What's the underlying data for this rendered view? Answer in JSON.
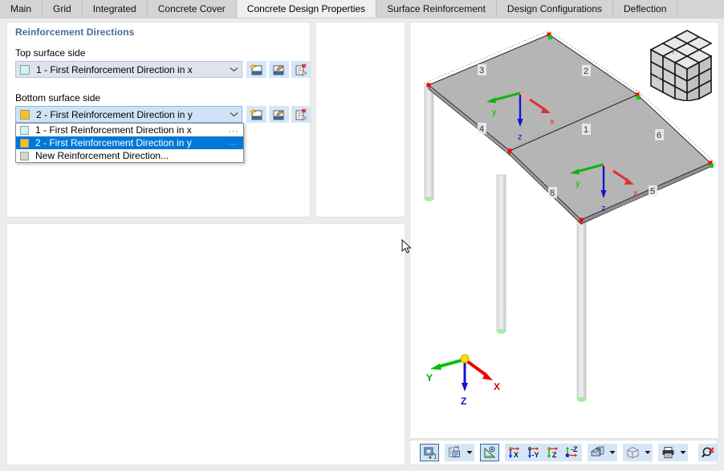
{
  "tabs": [
    {
      "label": "Main",
      "active": false
    },
    {
      "label": "Grid",
      "active": false
    },
    {
      "label": "Integrated",
      "active": false
    },
    {
      "label": "Concrete Cover",
      "active": false
    },
    {
      "label": "Concrete Design Properties",
      "active": true
    },
    {
      "label": "Surface Reinforcement",
      "active": false
    },
    {
      "label": "Design Configurations",
      "active": false
    },
    {
      "label": "Deflection",
      "active": false
    }
  ],
  "panel": {
    "title": "Reinforcement Directions",
    "top_label": "Top surface side",
    "bottom_label": "Bottom surface side",
    "top_combo": {
      "value": "1 - First Reinforcement Direction in x",
      "swatch_color": "#ccf5f5"
    },
    "bottom_combo": {
      "value": "2 - First Reinforcement Direction in y",
      "swatch_color": "#fcbe1e"
    },
    "row_buttons": [
      {
        "name": "new-reinforcement-direction-button",
        "icon": "new-window-icon",
        "tooltip": "New"
      },
      {
        "name": "edit-reinforcement-direction-button",
        "icon": "edit-window-icon",
        "tooltip": "Edit"
      },
      {
        "name": "delete-reinforcement-direction-button",
        "icon": "delete-entry-icon",
        "tooltip": "Delete"
      }
    ],
    "dropdown": {
      "open": true,
      "items": [
        {
          "label": "1 - First Reinforcement Direction in x",
          "swatch_color": "#ccf5f5",
          "selected": false,
          "has_ellipsis": true,
          "ellipsis": "..."
        },
        {
          "label": "2 - First Reinforcement Direction in y",
          "swatch_color": "#fcbe1e",
          "selected": true,
          "has_ellipsis": true,
          "ellipsis": "..."
        },
        {
          "label": "New Reinforcement Direction...",
          "swatch_color": "#d4d4d4",
          "selected": false,
          "has_ellipsis": false,
          "ellipsis": ""
        }
      ]
    }
  },
  "viewport": {
    "surface_labels": [
      "1",
      "2",
      "3",
      "4",
      "5",
      "6",
      "8"
    ],
    "local_axes": [
      {
        "x": "x",
        "y": "y",
        "z": "z"
      },
      {
        "x": "x",
        "y": "y",
        "z": "z"
      }
    ],
    "global_axes": {
      "x": "X",
      "y": "Y",
      "z": "Z"
    },
    "colors": {
      "axis_x": "#e03030",
      "axis_y": "#10b410",
      "axis_z": "#1414d2",
      "surface_fill": "#b5b5b5",
      "node_red": "#ff0000",
      "node_green": "#00d000"
    }
  },
  "view_toolbar": {
    "buttons": [
      {
        "name": "rendering-toggle-button",
        "icon": "render-mode-icon",
        "framed": true,
        "arrow": false
      },
      {
        "name": "display-properties-button",
        "icon": "display-properties-icon",
        "framed": false,
        "arrow": true
      },
      {
        "name": "measure-button",
        "icon": "ruler-protractor-icon",
        "framed": true,
        "arrow": false
      },
      {
        "name": "view-in-x-button",
        "icon": "view-x-icon",
        "label": "X",
        "framed": false,
        "arrow": false
      },
      {
        "name": "view-in-minus-y-button",
        "icon": "view-minus-y-icon",
        "label": "-Y",
        "framed": false,
        "arrow": false
      },
      {
        "name": "view-in-z-button",
        "icon": "view-z-icon",
        "label": "Z",
        "framed": false,
        "arrow": false
      },
      {
        "name": "view-in-minus-z-button",
        "icon": "view-minus-z-icon",
        "label": "-Z",
        "framed": false,
        "arrow": false
      },
      {
        "name": "shading-mode-button",
        "icon": "solid-blocks-icon",
        "framed": false,
        "arrow": true
      },
      {
        "name": "projection-mode-button",
        "icon": "wireframe-cube-icon",
        "framed": false,
        "arrow": true
      },
      {
        "name": "print-button",
        "icon": "printer-icon",
        "framed": false,
        "arrow": true
      },
      {
        "name": "zoom-reset-button",
        "icon": "zoom-cancel-icon",
        "framed": false,
        "arrow": false
      }
    ]
  }
}
